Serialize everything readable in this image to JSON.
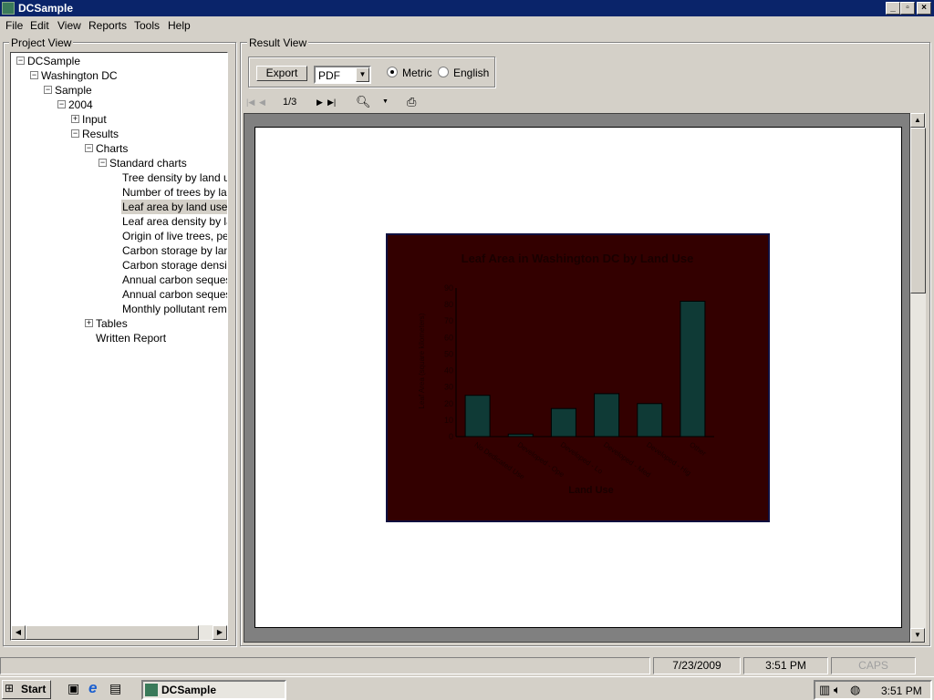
{
  "window": {
    "title": "DCSample"
  },
  "menu": [
    "File",
    "Edit",
    "View",
    "Reports",
    "Tools",
    "Help"
  ],
  "project_view": {
    "label": "Project View",
    "tree": [
      {
        "label": "DCSample",
        "level": 0,
        "expander": "minus"
      },
      {
        "label": "Washington DC",
        "level": 1,
        "expander": "minus"
      },
      {
        "label": "Sample",
        "level": 2,
        "expander": "minus"
      },
      {
        "label": "2004",
        "level": 3,
        "expander": "minus"
      },
      {
        "label": "Input",
        "level": 4,
        "expander": "plus"
      },
      {
        "label": "Results",
        "level": 4,
        "expander": "minus"
      },
      {
        "label": "Charts",
        "level": 5,
        "expander": "minus"
      },
      {
        "label": "Standard charts",
        "level": 6,
        "expander": "minus"
      },
      {
        "label": "Tree density by land use",
        "level": 7,
        "expander": "none"
      },
      {
        "label": "Number of trees by land use",
        "level": 7,
        "expander": "none"
      },
      {
        "label": "Leaf area by land use",
        "level": 7,
        "expander": "none",
        "selected": true
      },
      {
        "label": "Leaf area density by land use",
        "level": 7,
        "expander": "none"
      },
      {
        "label": "Origin of live trees, percent",
        "level": 7,
        "expander": "none"
      },
      {
        "label": "Carbon storage by land use",
        "level": 7,
        "expander": "none"
      },
      {
        "label": "Carbon storage density",
        "level": 7,
        "expander": "none"
      },
      {
        "label": "Annual carbon sequestration",
        "level": 7,
        "expander": "none"
      },
      {
        "label": "Annual carbon sequestration",
        "level": 7,
        "expander": "none"
      },
      {
        "label": "Monthly pollutant removal",
        "level": 7,
        "expander": "none"
      },
      {
        "label": "Tables",
        "level": 5,
        "expander": "plus"
      },
      {
        "label": "Written Report",
        "level": 5,
        "expander": "none"
      }
    ]
  },
  "result_view": {
    "label": "Result View",
    "export_label": "Export",
    "format_value": "PDF",
    "units": [
      {
        "label": "Metric",
        "checked": true
      },
      {
        "label": "English",
        "checked": false
      }
    ],
    "page_indicator": "1/3"
  },
  "chart_data": {
    "type": "bar",
    "title": "Leaf Area in Washington DC by Land Use",
    "xlabel": "Land Use",
    "ylabel": "Leaf Area (square kilometers)",
    "categories": [
      "No Dedicated Use",
      "Developed - Ope",
      "Developed - Lo",
      "Developed - Med",
      "Developed - Hig",
      "Other"
    ],
    "values": [
      25,
      1.5,
      17,
      26,
      20,
      82
    ],
    "ylim": [
      0,
      90
    ],
    "yticks": [
      0,
      10,
      20,
      30,
      40,
      50,
      60,
      70,
      80,
      90
    ],
    "grid": false,
    "colors": {
      "background": "#330000",
      "bar": "#0f3a36",
      "text": "#1a0000"
    }
  },
  "status": {
    "date": "7/23/2009",
    "time": "3:51 PM",
    "caps": "CAPS"
  },
  "taskbar": {
    "start": "Start",
    "task": "DCSample",
    "clock": "3:51 PM"
  }
}
